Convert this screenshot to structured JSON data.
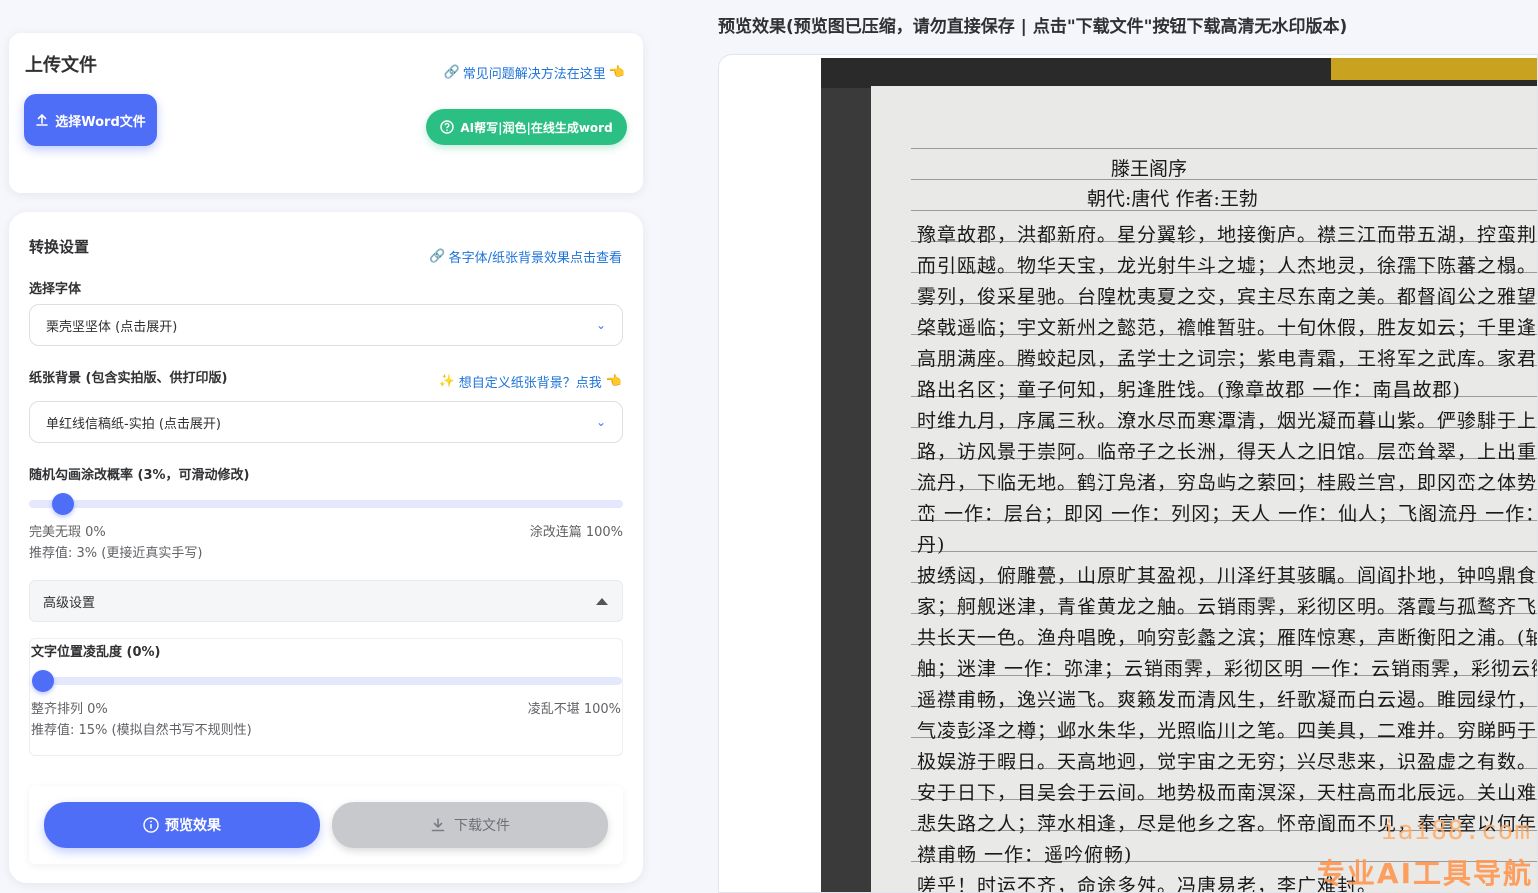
{
  "upload": {
    "title": "上传文件",
    "faq_link": "常见问题解决方法在这里",
    "upload_button": "选择Word文件",
    "ai_button": "AI帮写|润色|在线生成word"
  },
  "settings": {
    "title": "转换设置",
    "font_effect_link": "各字体/纸张背景效果点击查看",
    "font_label": "选择字体",
    "font_value": "栗壳坚坚体 (点击展开)",
    "paper_label": "纸张背景 (包含实拍版、供打印版)",
    "paper_custom_link": "想自定义纸张背景？点我",
    "paper_value": "单红线信稿纸-实拍 (点击展开)",
    "scribble": {
      "label": "随机勾画涂改概率 (3%，可滑动修改)",
      "value_percent": 3,
      "min_label": "完美无瑕 0%",
      "max_label": "涂改连篇 100%",
      "recommend": "推荐值: 3% (更接近真实手写)"
    },
    "advanced": {
      "label": "高级设置",
      "jitter_label": "文字位置凌乱度 (0%)",
      "value_percent": 0,
      "min_label": "整齐排列 0%",
      "max_label": "凌乱不堪 100%",
      "recommend": "推荐值: 15% (模拟自然书写不规则性)"
    },
    "preview_button": "预览效果",
    "download_button": "下载文件"
  },
  "preview": {
    "heading": "预览效果(预览图已压缩，请勿直接保存 | 点击\"下载文件\"按钮下载高清无水印版本)",
    "doc_title": "滕王阁序",
    "doc_subtitle": "朝代:唐代 作者:王勃",
    "lines": [
      "豫章故郡，洪都新府。星分翼轸，地接衡庐。襟三江而带五湖，控蛮荆",
      "而引瓯越。物华天宝，龙光射牛斗之墟；人杰地灵，徐孺下陈蕃之榻。雄州",
      "雾列，俊采星驰。台隍枕夷夏之交，宾主尽东南之美。都督阎公之雅望，",
      "棨戟遥临；宇文新州之懿范，襜帷暂驻。十旬休假，胜友如云；千里逢迎，",
      "高朋满座。腾蛟起凤，孟学士之词宗；紫电青霜，王将军之武库。家君作宰，",
      "路出名区；童子何知，躬逢胜饯。(豫章故郡 一作：南昌故郡)",
      "时维九月，序属三秋。潦水尽而寒潭清，烟光凝而暮山紫。俨骖騑于上",
      "路，访风景于崇阿。临帝子之长洲，得天人之旧馆。层峦耸翠，上出重霄；飞阁",
      "流丹，下临无地。鹤汀凫渚，穷岛屿之萦回；桂殿兰宫，即冈峦之体势。(层",
      "峦 一作：层台；即冈 一作：列冈；天人 一作：仙人；飞阁流丹 一作：飞阁翔",
      "丹)",
      "披绣闼，俯雕甍，山原旷其盈视，川泽纡其骇瞩。闾阎扑地，钟鸣鼎食之",
      "家；舸舰迷津，青雀黄龙之舳。云销雨霁，彩彻区明。落霞与孤鹜齐飞，秋水",
      "共长天一色。渔舟唱晚，响穷彭蠡之滨；雁阵惊寒，声断衡阳之浦。(轴 通：",
      "舳；迷津 一作：弥津；云销雨霁，彩彻区明 一作：云销雨霁，彩彻云衢)",
      "遥襟甫畅，逸兴遄飞。爽籁发而清风生，纤歌凝而白云遏。睢园绿竹，",
      "气凌彭泽之樽；邺水朱华，光照临川之笔。四美具，二难并。穷睇眄于中天，",
      "极娱游于暇日。天高地迥，觉宇宙之无穷；兴尽悲来，识盈虚之有数。望长",
      "安于日下，目吴会于云间。地势极而南溟深，天柱高而北辰远。关山难越，谁",
      "悲失路之人；萍水相逢，尽是他乡之客。怀帝阍而不见，奉宣室以何年？(遥",
      "襟甫畅 一作：遥吟俯畅)",
      "嗟乎！时运不齐，命途多舛。冯唐易老，李广难封。"
    ],
    "watermark_url": "iai88.com",
    "watermark_text": "专业AI工具导航"
  },
  "colors": {
    "primary": "#4f6ef7",
    "green": "#2cbf83",
    "link": "#1e73d8",
    "disabled": "#c8c9cc"
  }
}
